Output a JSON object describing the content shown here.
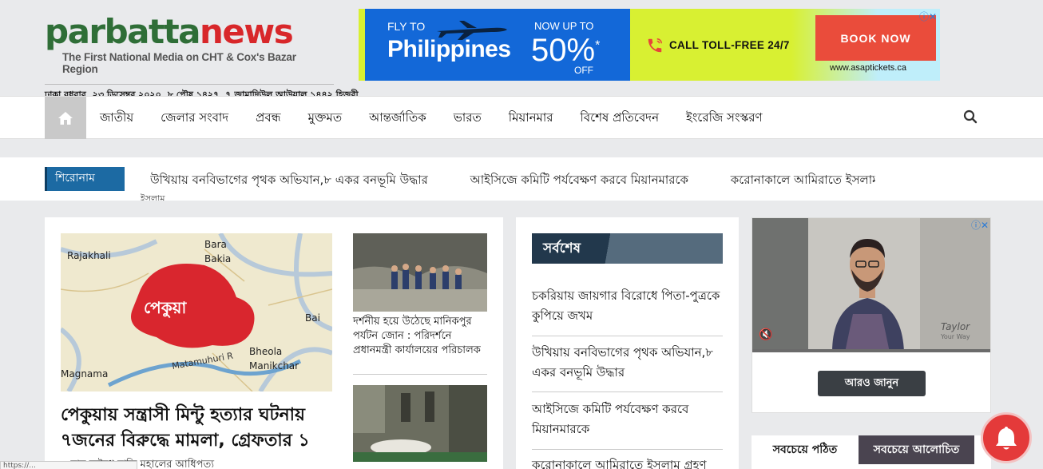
{
  "header": {
    "logo_part1": "parbatta",
    "logo_part2": "news",
    "tagline": "The First National Media on CHT & Cox's Bazar Region",
    "date_line": "ঢাকা বুধবার, ২৩ ডিসেম্বর ২০২০, ৮ পৌষ ১৪২৭, ৭ জামাদিউল আউয়াল ১৪৪২ হিজরী"
  },
  "top_ad": {
    "fly_to": "FLY TO",
    "destination": "Philippines",
    "now_up_to": "NOW UP TO",
    "percent": "50%",
    "asterisk": "*",
    "off": "OFF",
    "toll_free": "CALL TOLL-FREE 24/7",
    "book_now": "BOOK NOW",
    "site": "www.asaptickets.ca",
    "ad_info_glyph": "ⓘ✕"
  },
  "nav": {
    "items": [
      "জাতীয়",
      "জেলার সংবাদ",
      "প্রবন্ধ",
      "মুক্তমত",
      "আন্তর্জাতিক",
      "ভারত",
      "মিয়ানমার",
      "বিশেষ প্রতিবেদন",
      "ইংরেজি সংস্করণ"
    ]
  },
  "ticker": {
    "label": "শিরোনাম",
    "items": [
      "উখিয়ায় বনবিভাগের পৃথক অভিযান,৮ একর বনভূমি উদ্ধার",
      "আইসিজে কমিটি পর্যবেক্ষণ করবে মিয়ানমারকে",
      "করোনাকালে আমিরাতে ইসলাম"
    ],
    "overflow": "ইসলাম"
  },
  "lead": {
    "map_labels": {
      "l1": "Rajakhali",
      "l2": "Bara",
      "l3": "Bakia",
      "l4": "পেকুয়া",
      "l5": "Bai",
      "l6": "Bheola",
      "l7": "Manikchar",
      "l8": "Magnama",
      "l9": "Matamuhuri R"
    },
    "title": "পেকুয়ায় সন্ত্রাসী মিন্টু হত্যার ঘটনায় ৭জনের বিরুদ্ধে মামলা, গ্রেফতার ১",
    "next_title": "...য়ায় অবৈধ বালি মহালের আধিপত্য"
  },
  "side_news": {
    "item1": "দর্শনীয় হয়ে উঠেছে মানিকপুর পর্যটন জোন : পরিদর্শনে প্রধানমন্ত্রী কার্যালয়ের পরিচালক",
    "item2": "..."
  },
  "latest": {
    "heading": "সর্বশেষ",
    "items": [
      "চকরিয়ায় জায়গার বিরোধে পিতা-পুত্রকে কুপিয়ে জখম",
      "উখিয়ায় বনবিভাগের পৃথক অভিযান,৮ একর বনভূমি উদ্ধার",
      "আইসিজে কমিটি পর্যবেক্ষণ করবে মিয়ানমারকে",
      "করোনাকালে আমিরাতে ইসলাম গ্রহণ"
    ]
  },
  "video_ad": {
    "learn_more": "আরও জানুন",
    "brand": "Taylor",
    "brand_sub": "Your Way",
    "ad_info_glyph": "ⓘ✕",
    "mute_glyph": "🔇"
  },
  "tabs": {
    "most_read": "সবচেয়ে পঠিত",
    "most_discussed": "সবচেয়ে আলোচিত"
  },
  "status_url": "https://..."
}
